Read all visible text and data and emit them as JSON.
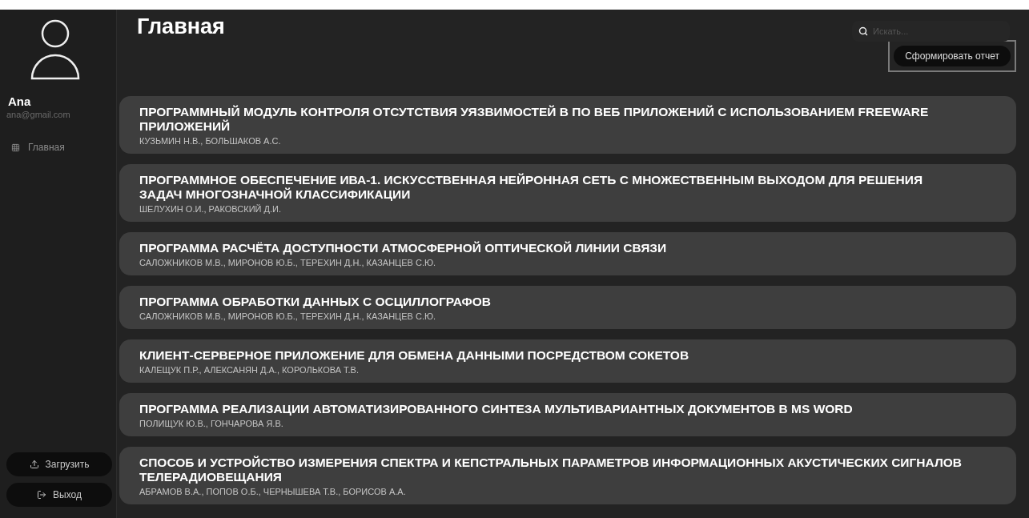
{
  "user": {
    "name": "Ana",
    "email": "ana@gmail.com"
  },
  "nav": [
    {
      "label": "Главная"
    }
  ],
  "sidebar_buttons": [
    {
      "kind": "upload",
      "label": "Загрузить"
    },
    {
      "kind": "logout",
      "label": "Выход"
    }
  ],
  "page_title": "Главная",
  "search": {
    "placeholder": "Искать..."
  },
  "report_button": "Сформировать отчет",
  "items": [
    {
      "title": "ПРОГРАММНЫЙ МОДУЛЬ КОНТРОЛЯ ОТСУТСТВИЯ УЯЗВИМОСТЕЙ В ПО ВЕБ ПРИЛОЖЕНИЙ С ИСПОЛЬЗОВАНИЕМ FREEWARE ПРИЛОЖЕНИЙ",
      "authors": "КУЗЬМИН Н.В., БОЛЬШАКОВ А.С."
    },
    {
      "title": "ПРОГРАММНОЕ ОБЕСПЕЧЕНИЕ ИВА-1. ИСКУССТВЕННАЯ НЕЙРОННАЯ СЕТЬ С МНОЖЕСТВЕННЫМ ВЫХОДОМ ДЛЯ РЕШЕНИЯ ЗАДАЧ МНОГОЗНАЧНОЙ КЛАССИФИКАЦИИ",
      "authors": "ШЕЛУХИН О.И., РАКОВСКИЙ Д.И."
    },
    {
      "title": "ПРОГРАММА РАСЧЁТА ДОСТУПНОСТИ АТМОСФЕРНОЙ ОПТИЧЕСКОЙ ЛИНИИ СВЯЗИ",
      "authors": "САЛОЖНИКОВ М.В., МИРОНОВ Ю.Б., ТЕРЕХИН Д.Н., КАЗАНЦЕВ С.Ю."
    },
    {
      "title": "ПРОГРАММА ОБРАБОТКИ ДАННЫХ С ОСЦИЛЛОГРАФОВ",
      "authors": "САЛОЖНИКОВ М.В., МИРОНОВ Ю.Б., ТЕРЕХИН Д.Н., КАЗАНЦЕВ С.Ю."
    },
    {
      "title": "КЛИЕНТ-СЕРВЕРНОЕ ПРИЛОЖЕНИЕ ДЛЯ ОБМЕНА ДАННЫМИ ПОСРЕДСТВОМ СОКЕТОВ",
      "authors": "КАЛЕЩУК П.Р., АЛЕКСАНЯН Д.А., КОРОЛЬКОВА Т.В."
    },
    {
      "title": "ПРОГРАММА РЕАЛИЗАЦИИ АВТОМАТИЗИРОВАННОГО СИНТЕЗА МУЛЬТИВАРИАНТНЫХ ДОКУМЕНТОВ В MS WORD",
      "authors": "ПОЛИЩУК Ю.В., ГОНЧАРОВА Я.В."
    },
    {
      "title": "СПОСОБ И УСТРОЙСТВО ИЗМЕРЕНИЯ СПЕКТРА И КЕПСТРАЛЬНЫХ ПАРАМЕТРОВ ИНФОРМАЦИОННЫХ АКУСТИЧЕСКИХ СИГНАЛОВ ТЕЛЕРАДИОВЕЩАНИЯ",
      "authors": "АБРАМОВ В.А., ПОПОВ О.Б., ЧЕРНЫШЕВА Т.В., БОРИСОВ А.А."
    }
  ]
}
